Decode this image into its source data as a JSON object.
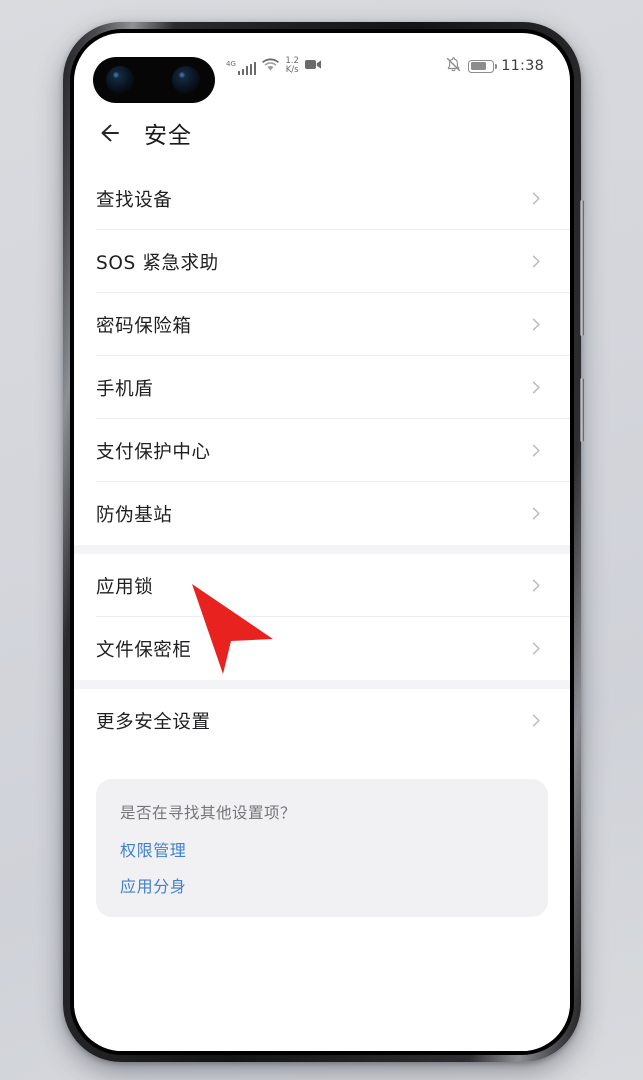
{
  "status_bar": {
    "network_type": "4G",
    "signal_icon": "signal-bars-icon",
    "wifi_icon": "wifi-icon",
    "data_speed_value": "1.2",
    "data_speed_unit": "K/s",
    "recording_icon": "video-recording-icon",
    "mute_icon": "bell-mute-icon",
    "battery_icon": "battery-icon",
    "time": "11:38"
  },
  "header": {
    "back_icon": "back-arrow-icon",
    "title": "安全"
  },
  "list": {
    "groups": [
      {
        "items": [
          {
            "label": "查找设备",
            "chevron": "chevron-right-icon"
          },
          {
            "label": "SOS 紧急求助",
            "chevron": "chevron-right-icon"
          },
          {
            "label": "密码保险箱",
            "chevron": "chevron-right-icon"
          },
          {
            "label": "手机盾",
            "chevron": "chevron-right-icon"
          },
          {
            "label": "支付保护中心",
            "chevron": "chevron-right-icon"
          },
          {
            "label": "防伪基站",
            "chevron": "chevron-right-icon"
          }
        ]
      },
      {
        "items": [
          {
            "label": "应用锁",
            "chevron": "chevron-right-icon"
          },
          {
            "label": "文件保密柜",
            "chevron": "chevron-right-icon"
          }
        ]
      },
      {
        "items": [
          {
            "label": "更多安全设置",
            "chevron": "chevron-right-icon"
          }
        ]
      }
    ]
  },
  "suggestion_card": {
    "title": "是否在寻找其他设置项？",
    "links": [
      {
        "label": "权限管理"
      },
      {
        "label": "应用分身"
      }
    ]
  },
  "cursor": {
    "type": "red-arrow-pointer",
    "points_at": "应用锁"
  },
  "colors": {
    "link_blue": "#4080d0",
    "cursor_red": "#e8221f",
    "page_background": "#d5d7dc",
    "screen_background": "#ffffff",
    "card_background": "#f1f1f3",
    "divider": "#ededef"
  }
}
